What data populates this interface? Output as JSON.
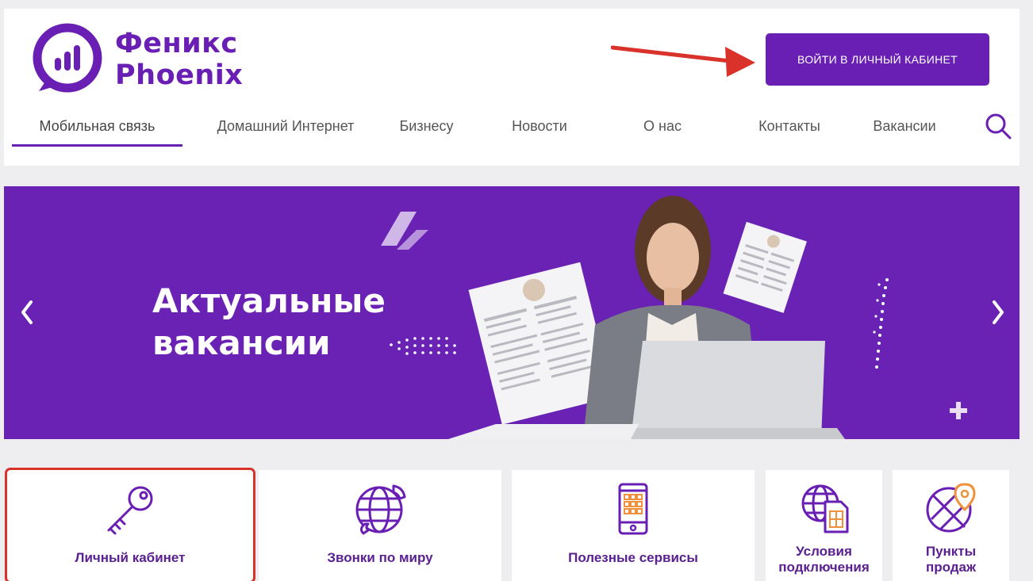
{
  "brand": {
    "name_ru": "Феникс",
    "name_en": "Phoenix",
    "color": "#6a1fb4"
  },
  "header": {
    "login_button": "ВОЙТИ В ЛИЧНЫЙ КАБИНЕТ"
  },
  "nav": {
    "items": [
      {
        "label": "Мобильная связь",
        "active": true
      },
      {
        "label": "Домашний Интернет",
        "active": false
      },
      {
        "label": "Бизнесу",
        "active": false
      },
      {
        "label": "Новости",
        "active": false
      },
      {
        "label": "О нас",
        "active": false
      },
      {
        "label": "Контакты",
        "active": false
      },
      {
        "label": "Вакансии",
        "active": false
      }
    ],
    "search_icon": "search-icon"
  },
  "banner": {
    "title_line1": "Актуальные",
    "title_line2": "вакансии",
    "background": "#6a22b5"
  },
  "cards": [
    {
      "label": "Личный кабинет",
      "icon": "key-icon",
      "highlighted": true
    },
    {
      "label": "Звонки по миру",
      "icon": "globe-phone-icon",
      "highlighted": false
    },
    {
      "label": "Полезные сервисы",
      "icon": "smartphone-apps-icon",
      "highlighted": false
    },
    {
      "label_line1": "Условия",
      "label_line2": "подключения",
      "icon": "globe-sim-icon",
      "highlighted": false
    },
    {
      "label_line1": "Пункты",
      "label_line2": "продаж",
      "icon": "map-pin-icon",
      "highlighted": false
    }
  ],
  "colors": {
    "accent": "#6a1fb4",
    "orange": "#f0903a",
    "annotation_red": "#d8322b"
  }
}
